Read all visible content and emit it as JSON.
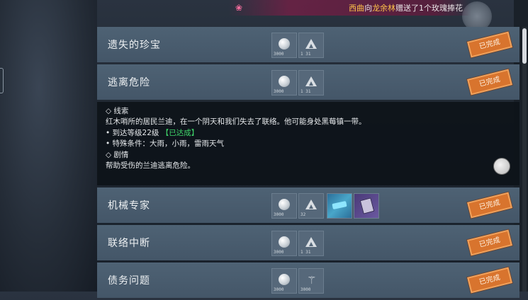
{
  "notice": {
    "sender": "西曲",
    "verb": "向",
    "receiver": "龙余林",
    "message": "赠送了1个玫瑰捧花"
  },
  "quests": [
    {
      "title": "遗失的珍宝",
      "status": "已完成",
      "rewards": [
        {
          "icon": "silver-coin-icon",
          "count": "3000"
        },
        {
          "icon": "mountain-icon",
          "count": "1 31"
        }
      ]
    },
    {
      "title": "逃离危险",
      "status": "已完成",
      "rewards": [
        {
          "icon": "silver-coin-icon",
          "count": "3000"
        },
        {
          "icon": "mountain-icon",
          "count": "1 31"
        }
      ]
    },
    {
      "title": "机械专家",
      "status": "已完成",
      "rewards": [
        {
          "icon": "silver-coin-icon",
          "count": "3000"
        },
        {
          "icon": "mountain-icon",
          "count": "32"
        },
        {
          "icon": "blue-scroll-icon",
          "count": ""
        },
        {
          "icon": "purple-book-icon",
          "count": ""
        }
      ]
    },
    {
      "title": "联络中断",
      "status": "已完成",
      "rewards": [
        {
          "icon": "silver-coin-icon",
          "count": "3000"
        },
        {
          "icon": "mountain-icon",
          "count": "1 31"
        }
      ]
    },
    {
      "title": "债务问题",
      "status": "已完成",
      "rewards": [
        {
          "icon": "silver-coin-icon",
          "count": "3000"
        },
        {
          "icon": "rune-icon",
          "count": "3000"
        }
      ]
    }
  ],
  "detail": {
    "clue_heading": "◇ 线索",
    "clue_text": "红木哨所的居民兰迪，在一个阴天和我们失去了联络。他可能身处黑莓镇一带。",
    "req_level": "• 到达等级22级",
    "req_level_status": "【已达成】",
    "req_weather": "• 特殊条件：大雨，小雨，雷雨天气",
    "plot_heading": "◇ 剧情",
    "plot_text": "帮助受伤的兰迪逃离危险。"
  }
}
